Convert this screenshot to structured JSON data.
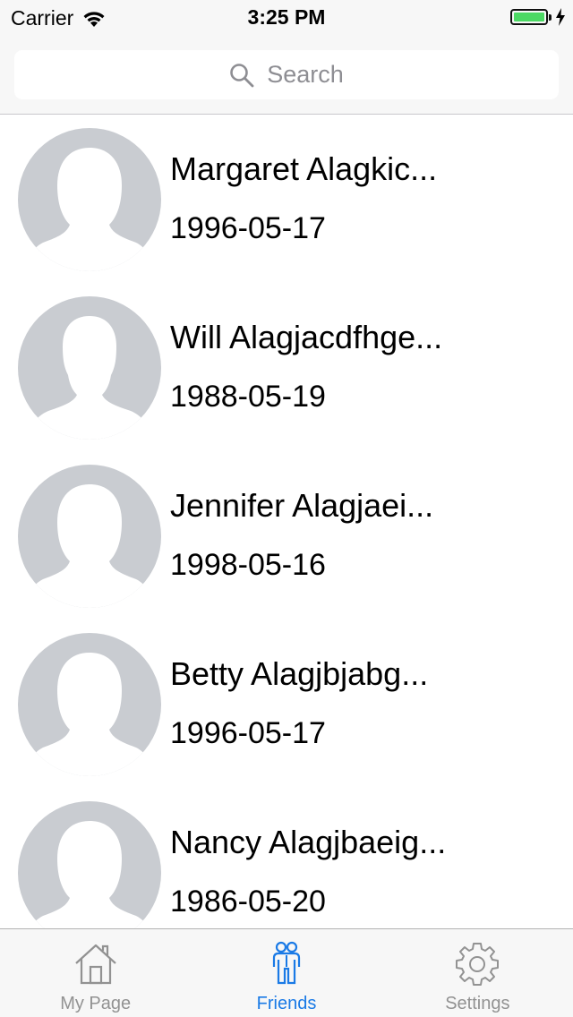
{
  "status_bar": {
    "carrier": "Carrier",
    "time": "3:25 PM",
    "battery_level": 1.0,
    "battery_color": "#4cd964"
  },
  "search": {
    "placeholder": "Search",
    "icon": "search-icon"
  },
  "friends": [
    {
      "name": "Margaret Alagkic...",
      "birthdate": "1996-05-17",
      "avatar": "female-silhouette"
    },
    {
      "name": "Will Alagjacdfhge...",
      "birthdate": "1988-05-19",
      "avatar": "male-silhouette"
    },
    {
      "name": "Jennifer Alagjaei...",
      "birthdate": "1998-05-16",
      "avatar": "female-silhouette"
    },
    {
      "name": "Betty Alagjbjabg...",
      "birthdate": "1996-05-17",
      "avatar": "female-silhouette"
    },
    {
      "name": "Nancy Alagjbaeig...",
      "birthdate": "1986-05-20",
      "avatar": "female-silhouette"
    }
  ],
  "tab_bar": {
    "active_color": "#1a7ae6",
    "inactive_color": "#929292",
    "tabs": [
      {
        "label": "My Page",
        "icon": "home-icon",
        "active": false
      },
      {
        "label": "Friends",
        "icon": "friends-icon",
        "active": true
      },
      {
        "label": "Settings",
        "icon": "gear-icon",
        "active": false
      }
    ]
  }
}
